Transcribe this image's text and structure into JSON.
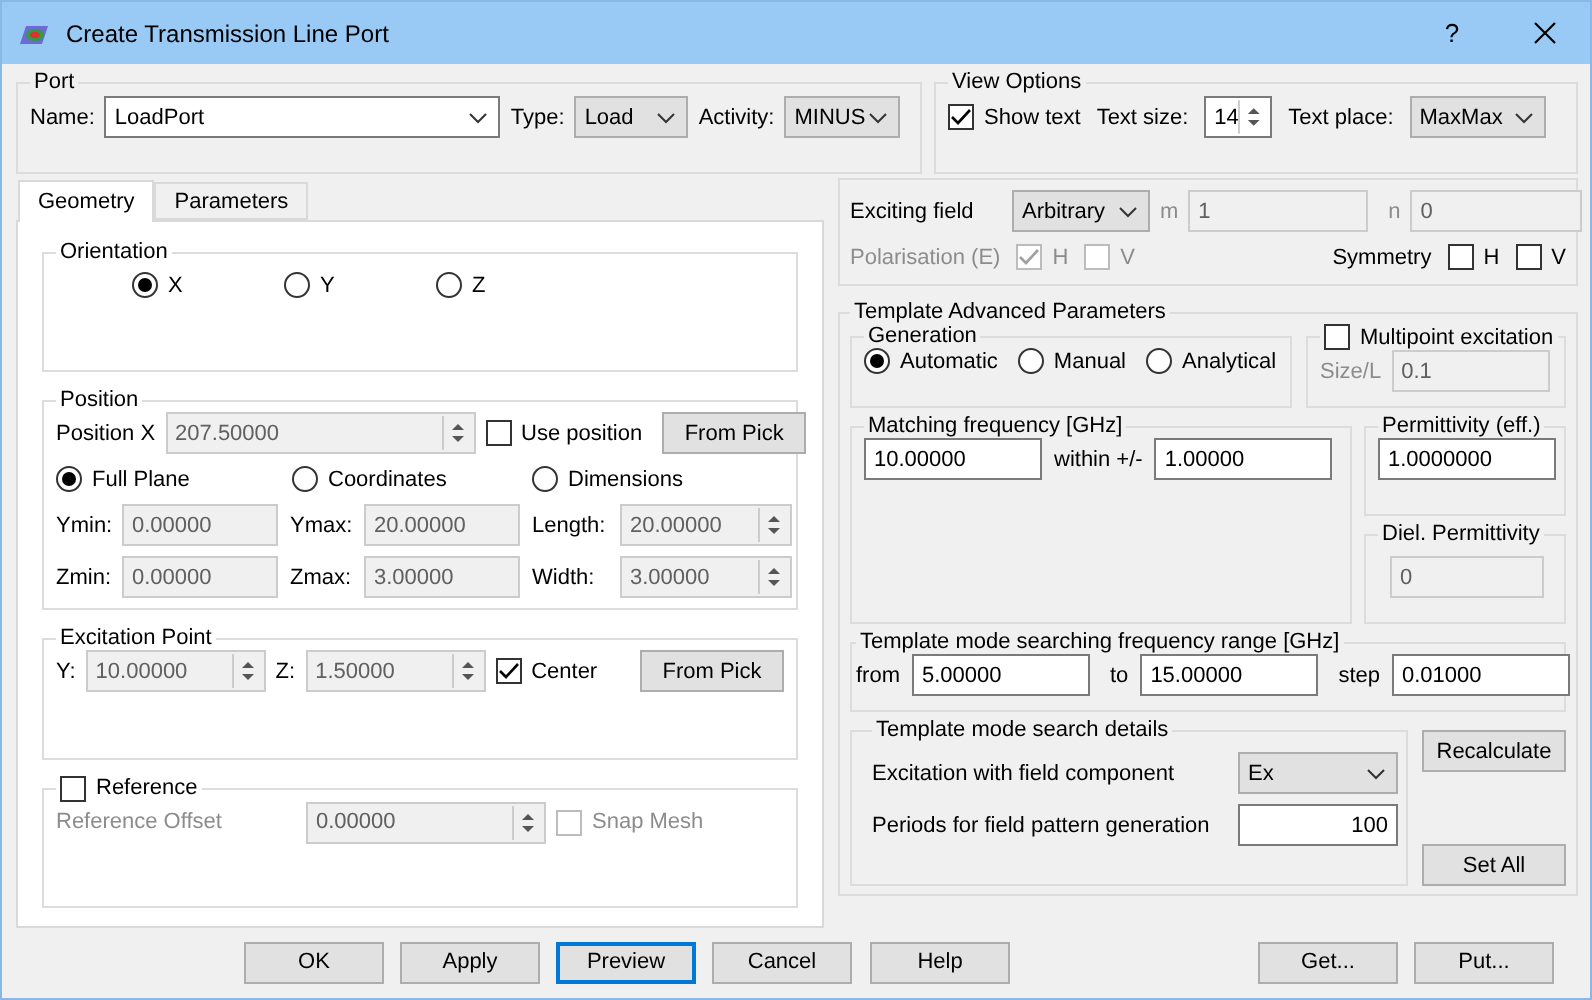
{
  "window": {
    "title": "Create Transmission Line Port",
    "help": "?"
  },
  "port": {
    "title": "Port",
    "name_label": "Name:",
    "name": "LoadPort",
    "type_label": "Type:",
    "type": "Load",
    "activity_label": "Activity:",
    "activity": "MINUS"
  },
  "view_options": {
    "title": "View Options",
    "show_text": {
      "label": "Show text",
      "checked": true
    },
    "text_size_label": "Text size:",
    "text_size": "14",
    "text_place_label": "Text place:",
    "text_place": "MaxMax"
  },
  "tabs": [
    {
      "label": "Geometry",
      "selected": true
    },
    {
      "label": "Parameters",
      "selected": false
    }
  ],
  "orientation": {
    "title": "Orientation",
    "options": [
      {
        "label": "X",
        "selected": true
      },
      {
        "label": "Y",
        "selected": false
      },
      {
        "label": "Z",
        "selected": false
      }
    ]
  },
  "position": {
    "title": "Position",
    "x_label": "Position X",
    "x_field": {
      "value": "207.50000",
      "disabled": true
    },
    "use_position": {
      "label": "Use position",
      "checked": false
    },
    "pick_button": "From Pick",
    "modes": [
      {
        "label": "Full Plane",
        "selected": true
      },
      {
        "label": "Coordinates",
        "selected": false
      },
      {
        "label": "Dimensions",
        "selected": false
      }
    ],
    "fields": [
      {
        "label": "Ymin:",
        "value": "0.00000",
        "disabled": true,
        "kind": "text"
      },
      {
        "label": "Ymax:",
        "value": "20.00000",
        "disabled": true,
        "kind": "text"
      },
      {
        "label": "Length:",
        "value": "20.00000",
        "disabled": true,
        "kind": "spin"
      },
      {
        "label": "Zmin:",
        "value": "0.00000",
        "disabled": true,
        "kind": "text"
      },
      {
        "label": "Zmax:",
        "value": "3.00000",
        "disabled": true,
        "kind": "text"
      },
      {
        "label": "Width:",
        "value": "3.00000",
        "disabled": true,
        "kind": "spin"
      }
    ]
  },
  "excitation_point": {
    "title": "Excitation Point",
    "y_label": "Y:",
    "y_field": {
      "value": "10.00000",
      "disabled": true
    },
    "z_label": "Z:",
    "z_field": {
      "value": "1.50000",
      "disabled": true
    },
    "center": {
      "label": "Center",
      "checked": true
    },
    "pick_button": "From Pick"
  },
  "reference": {
    "toggle": {
      "label": "Reference",
      "checked": false
    },
    "offset_label": "Reference Offset",
    "offset_field": {
      "value": "0.00000",
      "disabled": true
    },
    "snap_mesh": {
      "label": "Snap Mesh",
      "checked": false,
      "disabled": true
    }
  },
  "exciting_field": {
    "label": "Exciting field",
    "mode": "Arbitrary",
    "m_label": "m",
    "m_field": {
      "value": "1",
      "disabled": true
    },
    "n_label": "n",
    "n_field": {
      "value": "0",
      "disabled": true
    },
    "polarisation_label": "Polarisation (E)",
    "polarisation": [
      {
        "label": "H",
        "checked": true,
        "disabled": true
      },
      {
        "label": "V",
        "checked": false,
        "disabled": true
      }
    ],
    "symmetry_label": "Symmetry",
    "symmetry": [
      {
        "label": "H",
        "checked": false
      },
      {
        "label": "V",
        "checked": false
      }
    ]
  },
  "template_advanced": {
    "title": "Template Advanced Parameters",
    "generation": {
      "title": "Generation",
      "options": [
        {
          "label": "Automatic",
          "selected": true
        },
        {
          "label": "Manual",
          "selected": false
        },
        {
          "label": "Analytical",
          "selected": false
        }
      ]
    },
    "multipoint": {
      "label": "Multipoint excitation",
      "checked": false,
      "size_label": "Size/L",
      "size_field": {
        "value": "0.1",
        "disabled": true
      }
    },
    "matching": {
      "title": "Matching frequency [GHz]",
      "field": {
        "value": "10.00000"
      },
      "within_label": "within +/-",
      "within_field": {
        "value": "1.00000"
      }
    },
    "permittivity_eff": {
      "title": "Permittivity (eff.)",
      "field": {
        "value": "1.0000000"
      }
    },
    "diel_permittivity": {
      "title": "Diel. Permittivity",
      "field": {
        "value": "0",
        "disabled": true
      }
    },
    "search_range": {
      "title": "Template mode searching frequency range [GHz]",
      "from_label": "from",
      "from_field": {
        "value": "5.00000"
      },
      "to_label": "to",
      "to_field": {
        "value": "15.00000"
      },
      "step_label": "step",
      "step_field": {
        "value": "0.01000"
      }
    },
    "search_details": {
      "title": "Template mode search details",
      "component_label": "Excitation with field component",
      "component": "Ex",
      "periods_label": "Periods for field pattern generation",
      "periods_field": {
        "value": "100"
      }
    },
    "recalculate_button": "Recalculate",
    "set_all_button": "Set All"
  },
  "buttons": [
    {
      "label": "OK",
      "focused": false
    },
    {
      "label": "Apply",
      "focused": false
    },
    {
      "label": "Preview",
      "focused": true
    },
    {
      "label": "Cancel",
      "focused": false
    },
    {
      "label": "Help",
      "focused": false
    }
  ],
  "side_buttons": [
    {
      "label": "Get...",
      "focused": false
    },
    {
      "label": "Put...",
      "focused": false
    }
  ]
}
